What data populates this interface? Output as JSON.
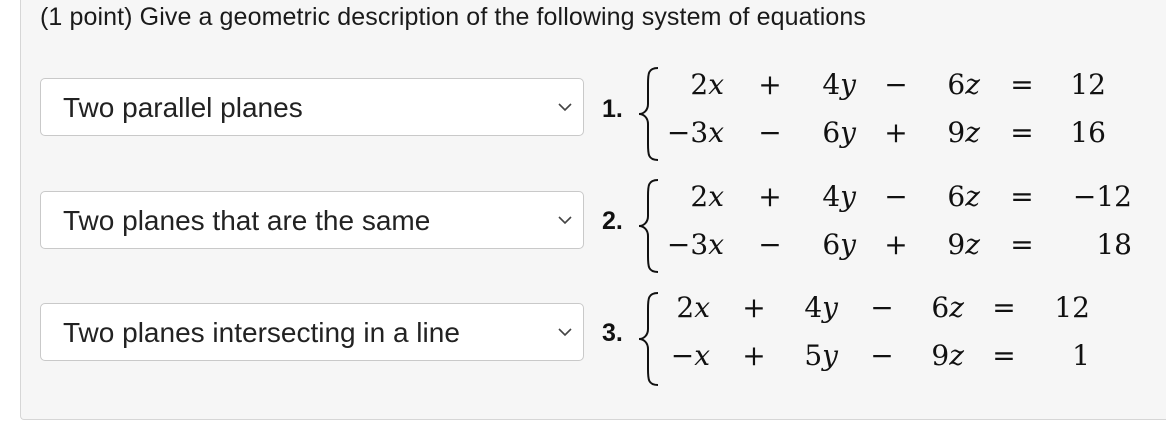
{
  "question": "(1 point) Give a geometric description of the following system of equations",
  "problems": [
    {
      "number": "1.",
      "selected": "Two parallel planes",
      "equations": [
        {
          "x_coef": "2",
          "x_var": "x",
          "op1": "+",
          "y_coef": "4",
          "y_var": "y",
          "op2": "−",
          "z_coef": "6",
          "z_var": "z",
          "eq": "=",
          "rhs": "12"
        },
        {
          "x_coef": "−3",
          "x_var": "x",
          "op1": "−",
          "y_coef": "6",
          "y_var": "y",
          "op2": "+",
          "z_coef": "9",
          "z_var": "z",
          "eq": "=",
          "rhs": "16"
        }
      ]
    },
    {
      "number": "2.",
      "selected": "Two planes that are the same",
      "equations": [
        {
          "x_coef": "2",
          "x_var": "x",
          "op1": "+",
          "y_coef": "4",
          "y_var": "y",
          "op2": "−",
          "z_coef": "6",
          "z_var": "z",
          "eq": "=",
          "rhs": "−12"
        },
        {
          "x_coef": "−3",
          "x_var": "x",
          "op1": "−",
          "y_coef": "6",
          "y_var": "y",
          "op2": "+",
          "z_coef": "9",
          "z_var": "z",
          "eq": "=",
          "rhs": "18"
        }
      ]
    },
    {
      "number": "3.",
      "selected": "Two planes intersecting in a line",
      "equations": [
        {
          "x_coef": "2",
          "x_var": "x",
          "op1": "+",
          "y_coef": "4",
          "y_var": "y",
          "op2": "−",
          "z_coef": "6",
          "z_var": "z",
          "eq": "=",
          "rhs": "12"
        },
        {
          "x_coef": "−",
          "x_var": "x",
          "op1": "+",
          "y_coef": "5",
          "y_var": "y",
          "op2": "−",
          "z_coef": "9",
          "z_var": "z",
          "eq": "=",
          "rhs": "1"
        }
      ]
    }
  ],
  "icons": {
    "dropdown": "chevron-down-icon",
    "brace": "left-brace"
  }
}
